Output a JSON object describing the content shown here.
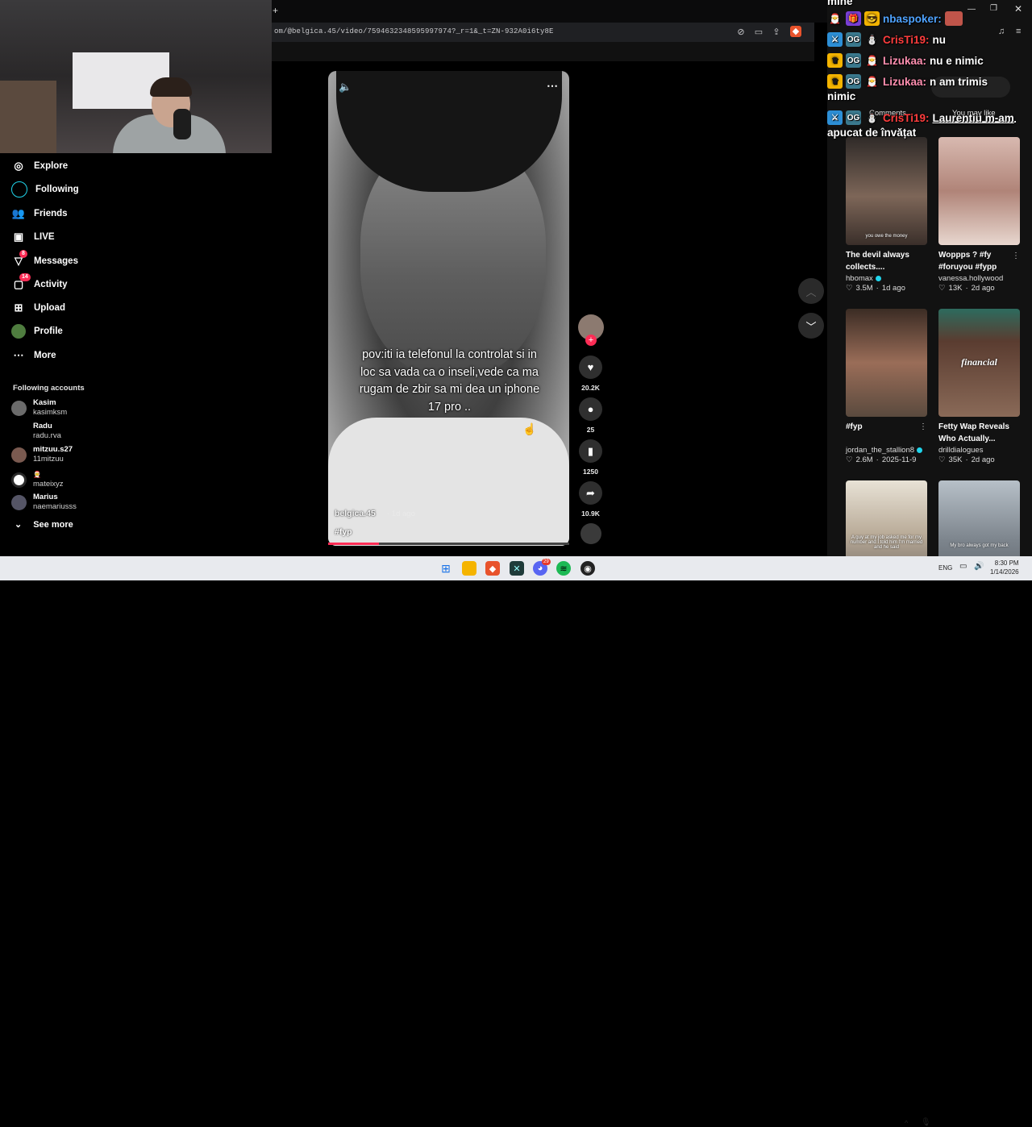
{
  "browser": {
    "url": "om/@belgica.45/video/7594632348595997974?_r=1&_t=ZN-932A0i6ty8E",
    "new_tab_symbol": "+"
  },
  "sidebar": {
    "items": [
      {
        "label": "Explore",
        "icon": "compass-icon"
      },
      {
        "label": "Following",
        "icon": "following-icon"
      },
      {
        "label": "Friends",
        "icon": "friends-icon"
      },
      {
        "label": "LIVE",
        "icon": "live-icon"
      },
      {
        "label": "Messages",
        "icon": "messages-icon",
        "badge": "8"
      },
      {
        "label": "Activity",
        "icon": "activity-icon",
        "badge": "14"
      },
      {
        "label": "Upload",
        "icon": "upload-icon"
      },
      {
        "label": "Profile",
        "icon": "profile-icon"
      },
      {
        "label": "More",
        "icon": "more-icon"
      }
    ],
    "following_heading": "Following accounts",
    "accounts": [
      {
        "name": "Kasim",
        "username": "kasimksm"
      },
      {
        "name": "Radu",
        "username": "radu.rva"
      },
      {
        "name": "mitzuu.s27",
        "username": "11mitzuu"
      },
      {
        "name": "",
        "username": "mateixyz"
      },
      {
        "name": "Marius",
        "username": "naemariusss"
      }
    ],
    "see_more": "See more"
  },
  "video": {
    "caption": "pov:iti ia telefonul la controlat si in loc sa vada ca o inseli,vede ca ma rugam de zbir sa mi dea un iphone 17 pro ..",
    "author": "belgica.45",
    "time": "· 1d ago",
    "hashtag": "#fyp",
    "progress": 0.21,
    "actions": {
      "likes": "20.2K",
      "comments": "25",
      "saves": "1250",
      "shares": "10.9K"
    }
  },
  "right_panel": {
    "tabs": [
      "Comments",
      "You may like"
    ],
    "cards": [
      {
        "title": "The devil always collects....",
        "author": "hbomax",
        "verified": true,
        "likes": "3.5M",
        "age": "1d ago",
        "thumb_text": "you owe the money",
        "thumb_color": "#6b5a50"
      },
      {
        "title": "Woppps ? #fy #foruyou #fypp",
        "author": "vanessa.hollywood",
        "verified": false,
        "likes": "13K",
        "age": "2d ago",
        "thumb_text": "",
        "thumb_color": "#c9a7a0"
      },
      {
        "title": "#fyp",
        "author": "jordan_the_stallion8",
        "verified": true,
        "likes": "2.6M",
        "age": "2025-11-9",
        "thumb_text": "",
        "thumb_color": "#7b6355"
      },
      {
        "title": "Fetty Wap Reveals Who Actually...",
        "author": "drilldialogues",
        "verified": false,
        "likes": "35K",
        "age": "2d ago",
        "thumb_text": "financial",
        "thumb_color": "#5a4036"
      },
      {
        "title": "",
        "author": "",
        "verified": false,
        "likes": "",
        "age": "",
        "thumb_text": "A guy at my job asked me for my number and I told him I'm married and he said",
        "thumb_color": "#cfc8bd"
      },
      {
        "title": "",
        "author": "",
        "verified": false,
        "likes": "",
        "age": "",
        "thumb_text": "My bro always got my back",
        "thumb_color": "#8c949c"
      }
    ]
  },
  "chat": [
    {
      "prefix": "mine",
      "user": "",
      "msg": ""
    },
    {
      "user": "nbaspoker:",
      "user_color": "#4fa3ff",
      "msg": ""
    },
    {
      "user": "CrisTi19:",
      "user_color": "#ff3d3d",
      "msg": "nu"
    },
    {
      "user": "Lizukaa:",
      "user_color": "#ff8fb0",
      "msg": "nu e nimic"
    },
    {
      "user": "Lizukaa:",
      "user_color": "#ff8fb0",
      "msg": "n am trimis"
    },
    {
      "user": "",
      "msg": "nimic"
    },
    {
      "user": "CrisTi19:",
      "user_color": "#ff3d3d",
      "msg": "Laurentiu m-am"
    },
    {
      "user": "",
      "msg": "apucat de învățat"
    }
  ],
  "taskbar": {
    "lang": "ENG",
    "time": "8:30 PM",
    "date": "1/14/2026",
    "discord_badge": "29"
  }
}
